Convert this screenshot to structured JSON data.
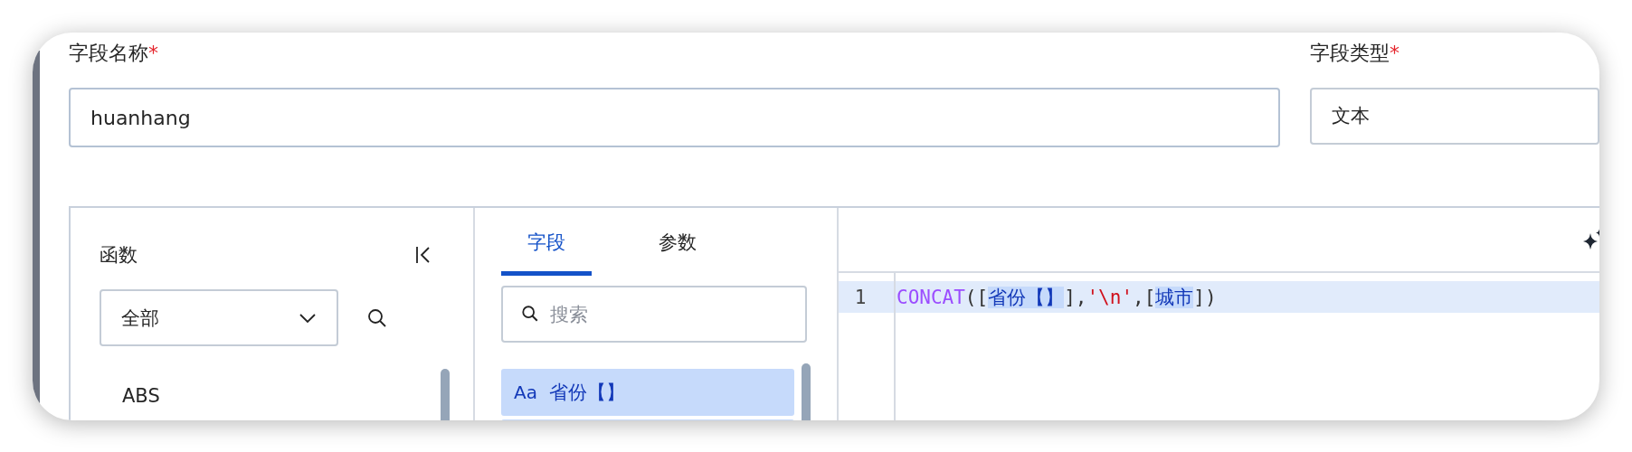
{
  "field_name": {
    "label": "字段名称",
    "required_mark": "*",
    "value": "huanhang"
  },
  "field_type": {
    "label": "字段类型",
    "required_mark": "*",
    "value": "文本"
  },
  "functions_panel": {
    "title": "函数",
    "category": "全部",
    "items": [
      "ABS"
    ]
  },
  "fields_panel": {
    "tabs": [
      {
        "label": "字段",
        "selected": true
      },
      {
        "label": "参数",
        "selected": false
      }
    ],
    "search": {
      "placeholder": "搜索"
    },
    "items": [
      {
        "type": "Aa",
        "name": "省份【】",
        "selected": true
      }
    ]
  },
  "editor": {
    "lines": [
      {
        "number": "1",
        "highlighted": true,
        "tokens": [
          {
            "kind": "function",
            "text": "CONCAT"
          },
          {
            "kind": "punct",
            "text": "(["
          },
          {
            "kind": "field",
            "text": "省份【】"
          },
          {
            "kind": "punct",
            "text": "],"
          },
          {
            "kind": "string",
            "text": "'\\n'"
          },
          {
            "kind": "punct",
            "text": ",["
          },
          {
            "kind": "field",
            "text": "城市"
          },
          {
            "kind": "punct",
            "text": "])"
          }
        ]
      }
    ]
  }
}
